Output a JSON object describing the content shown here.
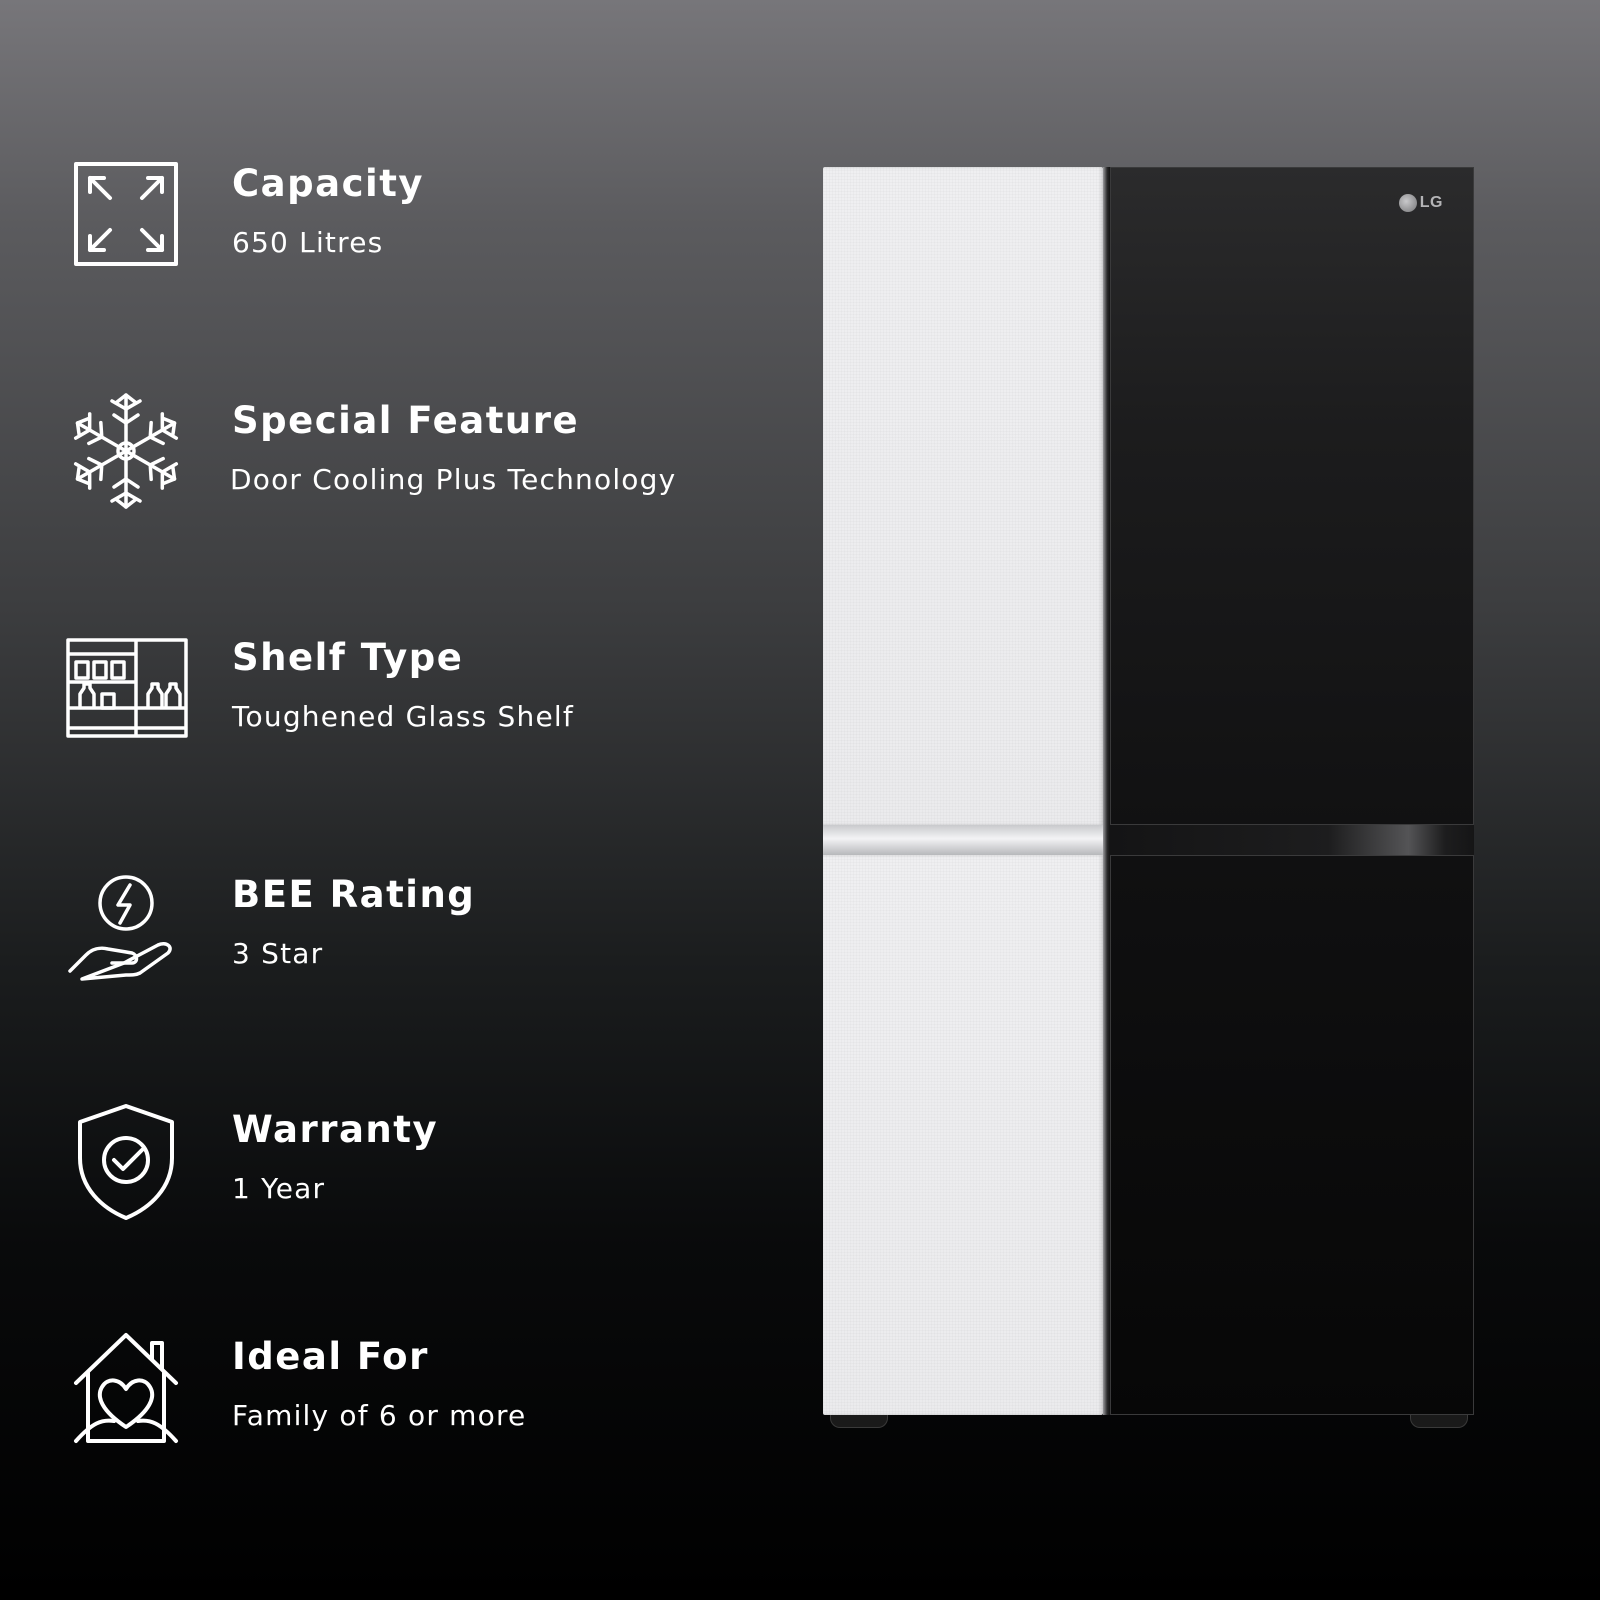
{
  "features": [
    {
      "title": "Capacity",
      "value": "650 Litres",
      "icon": "expand-arrows-icon"
    },
    {
      "title": "Special Feature",
      "value": "Door Cooling Plus Technology",
      "icon": "snowflake-icon"
    },
    {
      "title": "Shelf Type",
      "value": "Toughened Glass Shelf",
      "icon": "shelves-icon"
    },
    {
      "title": "BEE Rating",
      "value": "3 Star",
      "icon": "energy-hand-icon"
    },
    {
      "title": "Warranty",
      "value": "1 Year",
      "icon": "shield-check-icon"
    },
    {
      "title": "Ideal For",
      "value": "Family of 6 or more",
      "icon": "heart-home-icon"
    }
  ],
  "product": {
    "brand": "LG",
    "colors": {
      "left_door": "#eeeef0",
      "right_door": "#1a1a1b"
    }
  },
  "colors": {
    "background_top": "#77767a",
    "background_bottom": "#000000",
    "text": "#ffffff"
  }
}
